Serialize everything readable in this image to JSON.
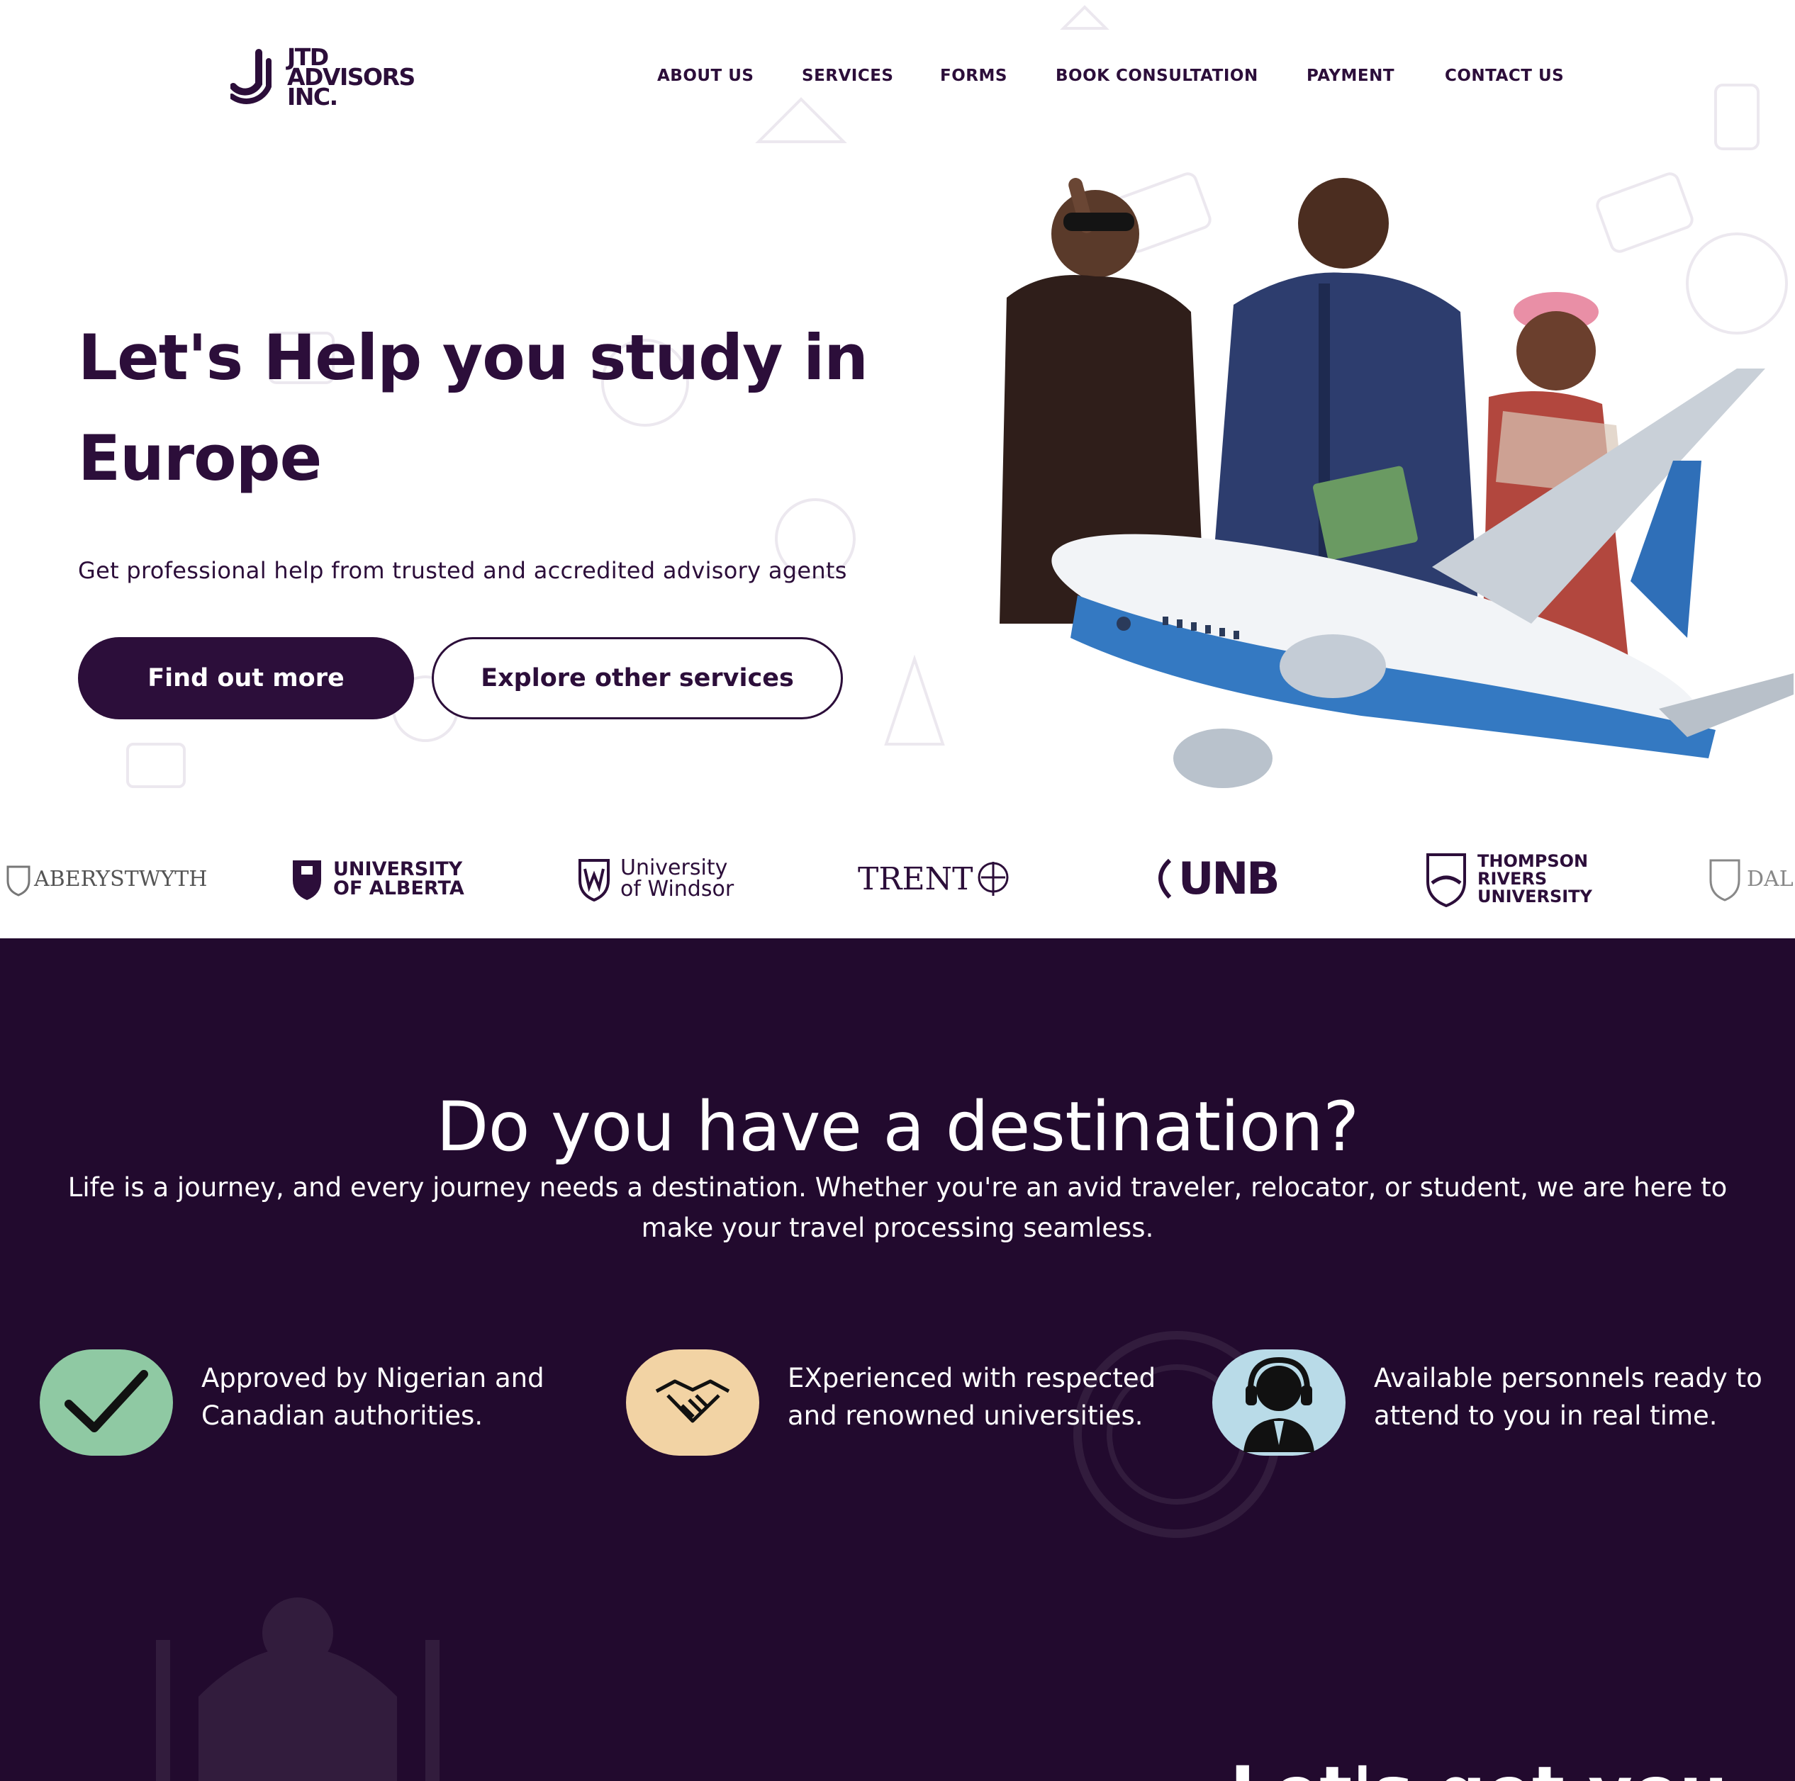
{
  "brand": {
    "logo_lines": [
      "JTD",
      "ADVISORS",
      "INC."
    ],
    "primary_color": "#2c0e3a",
    "dark_bg": "#220a2e"
  },
  "nav": {
    "items": [
      "ABOUT US",
      "SERVICES",
      "FORMS",
      "BOOK CONSULTATION",
      "PAYMENT",
      "CONTACT US"
    ]
  },
  "hero": {
    "title": "Let's Help you study in Europe",
    "subtitle": "Get professional help from trusted and accredited advisory agents",
    "primary_button": "Find out more",
    "secondary_button": "Explore other services"
  },
  "universities": [
    {
      "name": "ABERYSTWYTH",
      "icon": "aberystwyth-crest-icon"
    },
    {
      "name": "UNIVERSITY\nOF ALBERTA",
      "icon": "alberta-crest-icon"
    },
    {
      "name": "University\nof Windsor",
      "icon": "windsor-crest-icon"
    },
    {
      "name": "TRENT",
      "icon": "trent-crest-icon"
    },
    {
      "name": "UNB",
      "icon": "unb-crest-icon"
    },
    {
      "name": "THOMPSON\nRIVERS\nUNIVERSITY",
      "icon": "thompson-rivers-crest-icon"
    },
    {
      "name": "DAL",
      "icon": "dalhousie-crest-icon"
    }
  ],
  "destination": {
    "title": "Do you have a destination?",
    "description": "Life is a journey, and every journey needs a destination. Whether you're an avid traveler, relocator, or student, we are here to make your travel processing seamless."
  },
  "features": [
    {
      "icon": "checkmark-icon",
      "color": "#8fc9a3",
      "text": "Approved by Nigerian and Canadian authorities."
    },
    {
      "icon": "handshake-icon",
      "color": "#f2d3a4",
      "text": "EXperienced with respected and renowned universities."
    },
    {
      "icon": "support-agent-icon",
      "color": "#b9dbe8",
      "text": "Available personnels ready to attend to you in real time."
    }
  ],
  "next_section_title": "Let's get you"
}
